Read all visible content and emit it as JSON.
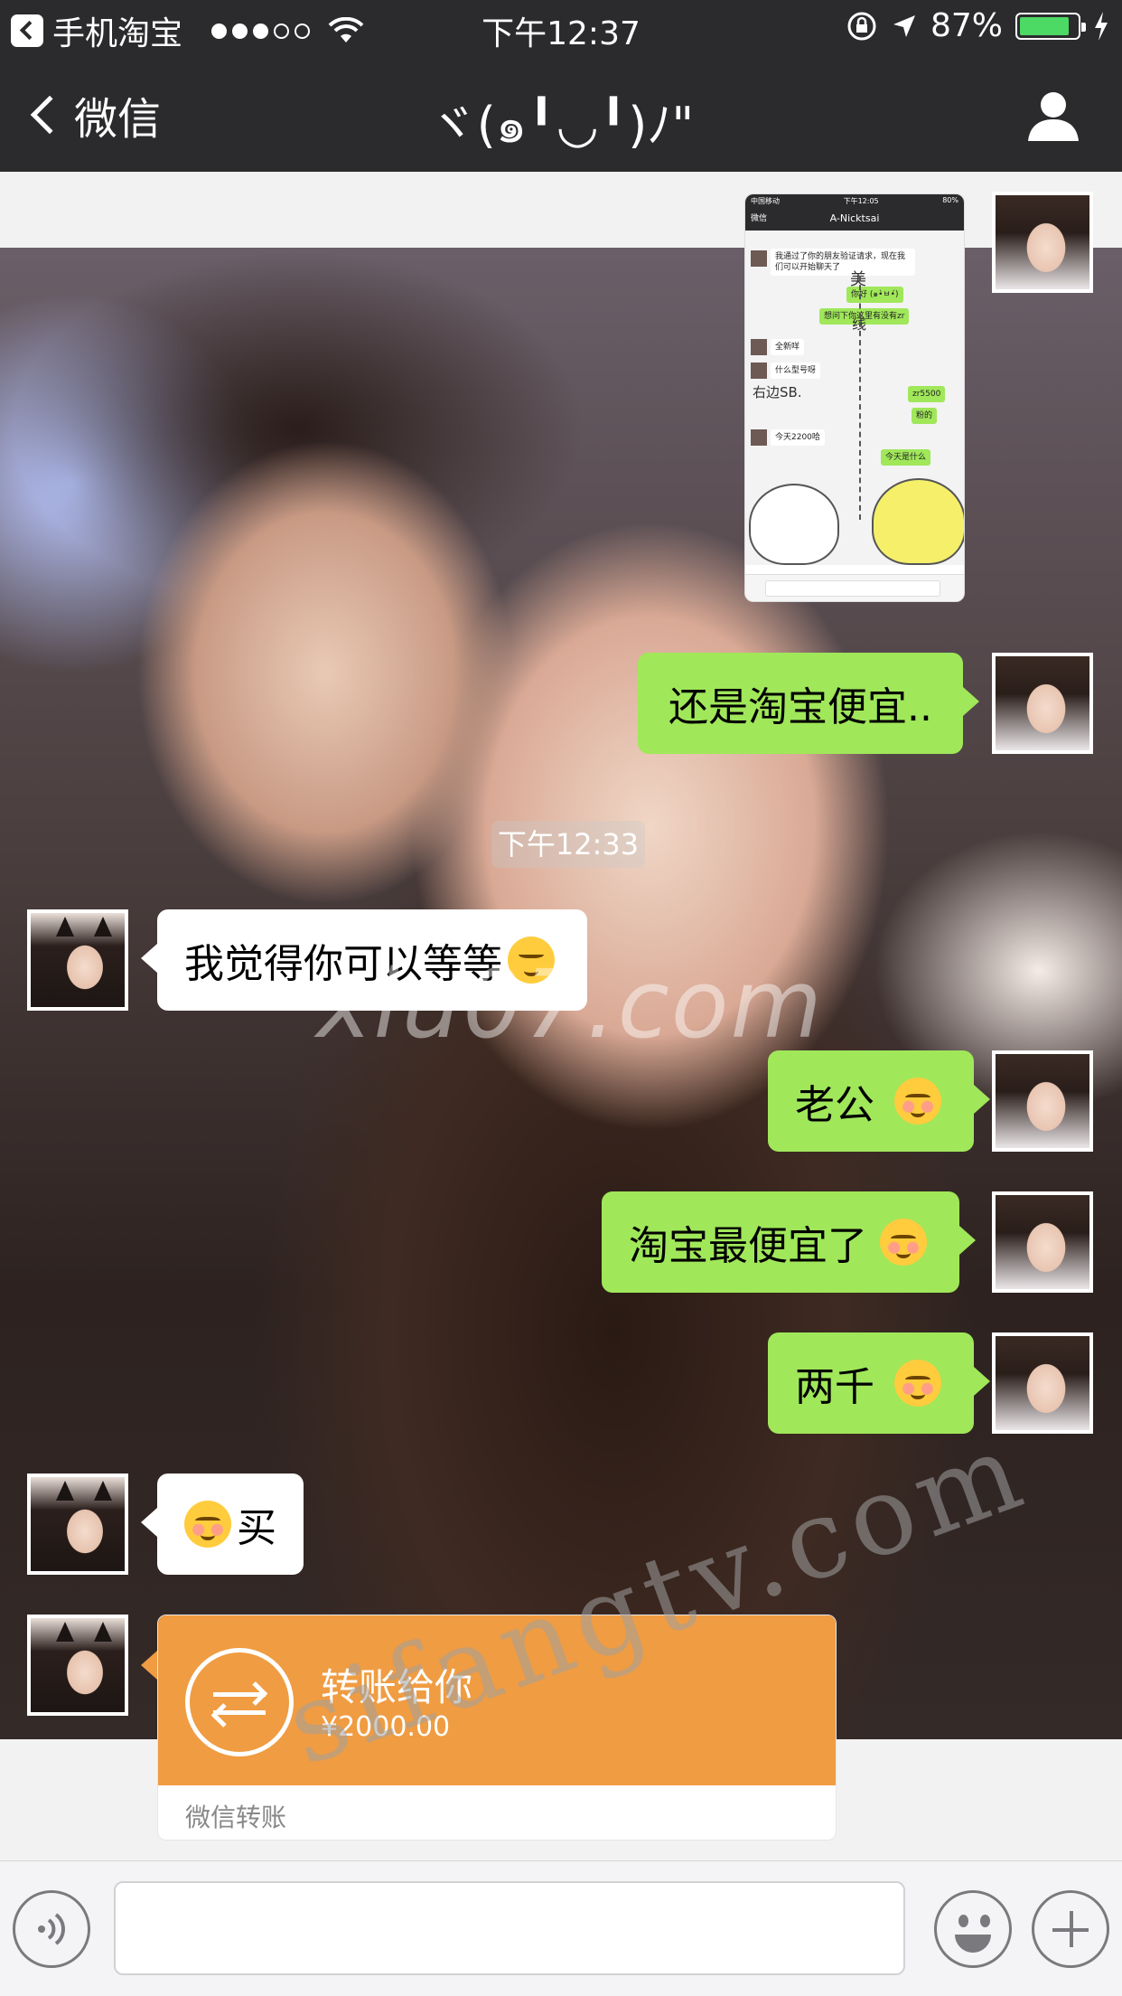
{
  "status_bar": {
    "carrier": "手机淘宝",
    "time": "下午12:37",
    "battery_text": "87%",
    "battery_level": 0.87
  },
  "nav": {
    "back_label": "微信",
    "title": "ヾ(๑╹◡╹)ﾉ\""
  },
  "chat": {
    "screenshot": {
      "status_left": "中国移动",
      "status_time": "下午12:05",
      "status_right": "80%",
      "back_label": "微信",
      "title": "A-Nicktsai",
      "messages": [
        "我通过了你的朋友验证请求，现在我们可以开始聊天了",
        "你好 (๑•̀ㅂ•́)",
        "想问下你这里有没有zr",
        "全新咩",
        "什么型号呀",
        "zr5500",
        "粉的",
        "今天2200哈",
        "今天是什么"
      ],
      "handwriting": [
        "美",
        "线",
        "右边SB."
      ]
    },
    "messages": [
      {
        "side": "right",
        "text": "还是淘宝便宜.."
      },
      {
        "side": "left",
        "text": "我觉得你可以等等"
      },
      {
        "side": "right",
        "text": "老公"
      },
      {
        "side": "right",
        "text": "淘宝最便宜了"
      },
      {
        "side": "right",
        "text": "两千"
      },
      {
        "side": "left",
        "text": "买"
      }
    ],
    "timestamp": "下午12:33",
    "transfer": {
      "title": "转账给你",
      "amount": "¥2000.00",
      "footer": "微信转账"
    },
    "watermarks": [
      "xiu07.com",
      "sifangtv.com"
    ]
  },
  "colors": {
    "nav_bg": "#2b2b2d",
    "bubble_right": "#a0e75a",
    "bubble_left": "#ffffff",
    "transfer": "#f09c42",
    "battery": "#4cd964"
  },
  "icons": [
    "back-app-icon",
    "wifi-icon",
    "lock-rotation-icon",
    "location-arrow-icon",
    "battery-icon",
    "charging-icon",
    "chevron-left-icon",
    "person-icon",
    "voice-icon",
    "emoji-icon",
    "plus-icon",
    "transfer-arrows-icon"
  ]
}
